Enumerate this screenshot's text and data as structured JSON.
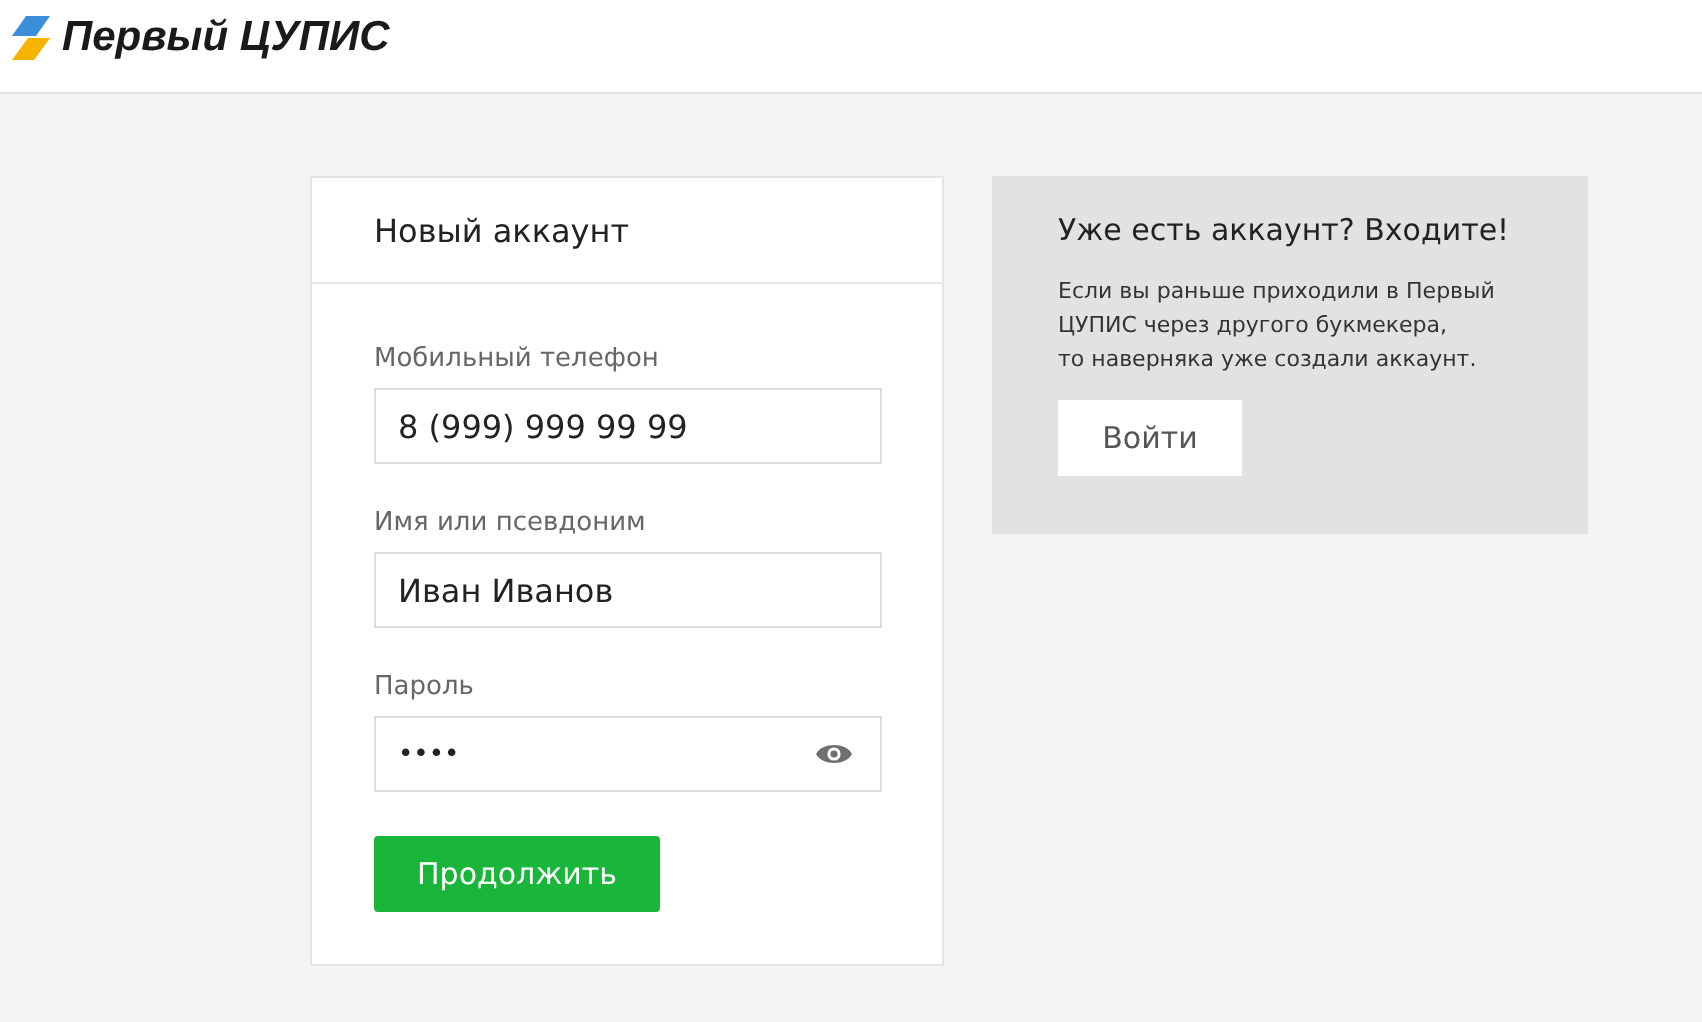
{
  "header": {
    "logo_text": "Первый ЦУПИС"
  },
  "signup": {
    "title": "Новый аккаунт",
    "fields": [
      {
        "kind": "text",
        "label": "Мобильный телефон",
        "value": "8 (999) 999 99 99"
      },
      {
        "kind": "text",
        "label": "Имя или псевдоним",
        "value": "Иван Иванов"
      },
      {
        "kind": "password",
        "label": "Пароль",
        "value": "••••"
      }
    ],
    "submit": "Продолжить"
  },
  "login": {
    "title": "Уже есть аккаунт? Входите!",
    "text": "Если вы раньше приходили в Первый ЦУПИС через другого букмекера,\nто наверняка уже создали аккаунт.",
    "button": "Войти"
  }
}
